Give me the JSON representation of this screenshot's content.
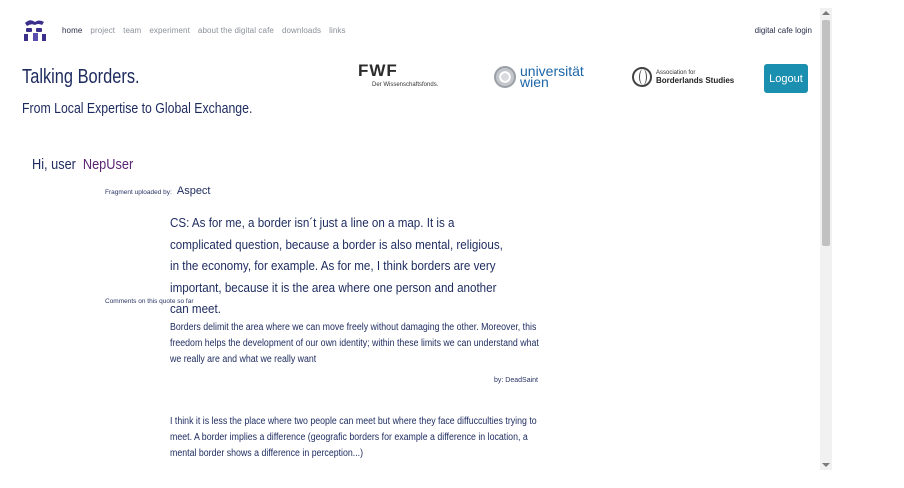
{
  "nav": {
    "items": [
      "home",
      "project",
      "team",
      "experiment",
      "about the digital cafe",
      "downloads",
      "links"
    ],
    "login": "digital cafe login"
  },
  "header": {
    "title": "Talking Borders.",
    "subtitle": "From Local Expertise to Global Exchange."
  },
  "sponsors": {
    "fwf_mark": "FWF",
    "fwf_sub": "Der Wissenschaftsfonds.",
    "uni_line1": "universität",
    "uni_line2": "wien",
    "abs_small": "Association for",
    "abs_name": "Borderlands Studies"
  },
  "logout_label": "Logout",
  "greeting": {
    "prefix": "Hi, user",
    "username": "NepUser"
  },
  "fragment": {
    "label": "Fragment uploaded by:",
    "author": "Aspect",
    "text": "CS: As for me, a border isn´t just a line on a map. It is a complicated question, because a border is also mental, religious, in the economy, for example. As for me, I think borders are very important, because it is the area where one person and another can meet."
  },
  "comments": {
    "label": "Comments on this quote so far",
    "items": [
      {
        "text": "Borders delimit the area where we can move freely without damaging the other. Moreover, this freedom helps the development of our own identity; within these limits we can understand what we really are and what we really want",
        "byline": "by: DeadSaint"
      },
      {
        "text": "I think it is less the place where two people can meet but where they face diffucculties trying to meet. A border implies a difference (geografic borders for example a difference in location, a mental border shows a difference in perception...)"
      }
    ]
  },
  "colors": {
    "accent": "#1a8fb0",
    "username": "#5b2473",
    "text": "#1c2a5e"
  }
}
